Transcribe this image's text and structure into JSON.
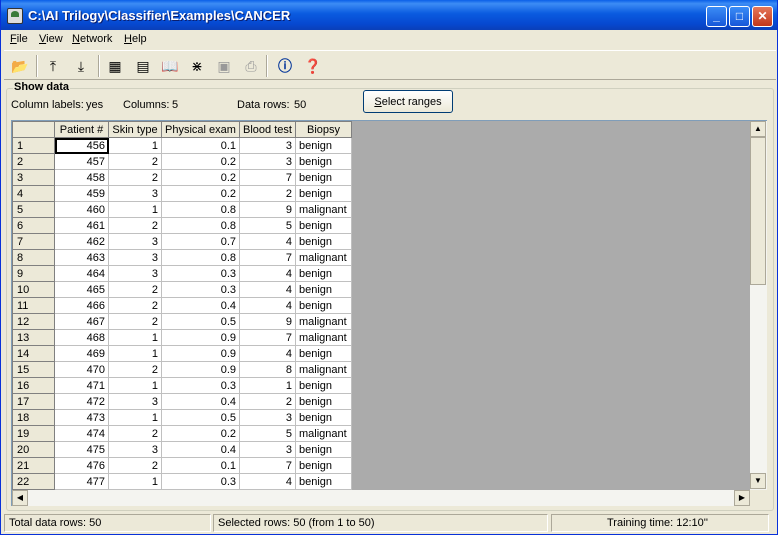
{
  "window": {
    "title": "C:\\AI Trilogy\\Classifier\\Examples\\CANCER",
    "minimize": "_",
    "maximize": "□",
    "close": "✕"
  },
  "menu": [
    {
      "key": "F",
      "rest": "ile"
    },
    {
      "key": "V",
      "rest": "iew"
    },
    {
      "key": "N",
      "rest": "etwork"
    },
    {
      "key": "H",
      "rest": "elp"
    }
  ],
  "toolbar_icons": [
    "open-folder-icon",
    "import-icon",
    "export-icon",
    "table-icon",
    "chart-icon",
    "book-icon",
    "network-icon",
    "save-icon",
    "print-icon",
    "info-icon",
    "help-icon"
  ],
  "section": {
    "title": "Show data"
  },
  "info": {
    "column_labels_label": "Column labels:",
    "column_labels_value": "yes",
    "columns_label": "Columns:",
    "columns_value": "5",
    "rows_label": "Data rows:",
    "rows_value": "50"
  },
  "select_button": {
    "key": "S",
    "rest": "elect ranges"
  },
  "table": {
    "headers": [
      "Patient #",
      "Skin type",
      "Physical exam",
      "Blood test",
      "Biopsy"
    ],
    "rows": [
      [
        "1",
        "456",
        "1",
        "0.1",
        "3",
        "benign"
      ],
      [
        "2",
        "457",
        "2",
        "0.2",
        "3",
        "benign"
      ],
      [
        "3",
        "458",
        "2",
        "0.2",
        "7",
        "benign"
      ],
      [
        "4",
        "459",
        "3",
        "0.2",
        "2",
        "benign"
      ],
      [
        "5",
        "460",
        "1",
        "0.8",
        "9",
        "malignant"
      ],
      [
        "6",
        "461",
        "2",
        "0.8",
        "5",
        "benign"
      ],
      [
        "7",
        "462",
        "3",
        "0.7",
        "4",
        "benign"
      ],
      [
        "8",
        "463",
        "3",
        "0.8",
        "7",
        "malignant"
      ],
      [
        "9",
        "464",
        "3",
        "0.3",
        "4",
        "benign"
      ],
      [
        "10",
        "465",
        "2",
        "0.3",
        "4",
        "benign"
      ],
      [
        "11",
        "466",
        "2",
        "0.4",
        "4",
        "benign"
      ],
      [
        "12",
        "467",
        "2",
        "0.5",
        "9",
        "malignant"
      ],
      [
        "13",
        "468",
        "1",
        "0.9",
        "7",
        "malignant"
      ],
      [
        "14",
        "469",
        "1",
        "0.9",
        "4",
        "benign"
      ],
      [
        "15",
        "470",
        "2",
        "0.9",
        "8",
        "malignant"
      ],
      [
        "16",
        "471",
        "1",
        "0.3",
        "1",
        "benign"
      ],
      [
        "17",
        "472",
        "3",
        "0.4",
        "2",
        "benign"
      ],
      [
        "18",
        "473",
        "1",
        "0.5",
        "3",
        "benign"
      ],
      [
        "19",
        "474",
        "2",
        "0.2",
        "5",
        "malignant"
      ],
      [
        "20",
        "475",
        "3",
        "0.4",
        "3",
        "benign"
      ],
      [
        "21",
        "476",
        "2",
        "0.1",
        "7",
        "benign"
      ],
      [
        "22",
        "477",
        "1",
        "0.3",
        "4",
        "benign"
      ]
    ]
  },
  "status": {
    "total": "Total data rows: 50",
    "selected": "Selected rows: 50  (from 1 to 50)",
    "training": "Training time: 12:10''"
  }
}
